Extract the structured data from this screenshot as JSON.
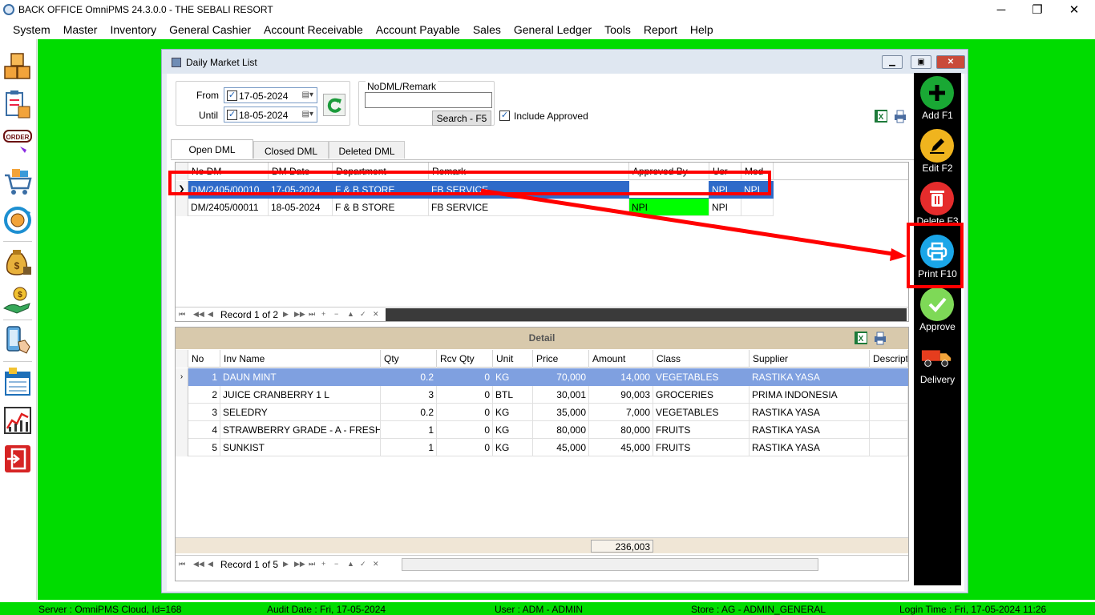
{
  "window": {
    "title": "BACK OFFICE OmniPMS 24.3.0.0 - THE SEBALI RESORT",
    "controls": {
      "minimize": "─",
      "restore": "❐",
      "close": "✕"
    }
  },
  "menu": [
    "System",
    "Master",
    "Inventory",
    "General Cashier",
    "Account Receivable",
    "Account Payable",
    "Sales",
    "General Ledger",
    "Tools",
    "Report",
    "Help"
  ],
  "left_toolbar": {
    "icons": [
      "boxes-icon",
      "clipboard-box-icon",
      "order-icon",
      "shopping-cart-icon",
      "sync-icon",
      "money-bag-icon",
      "hand-money-icon",
      "phone-touch-icon",
      "calendar-report-icon",
      "chart-icon",
      "exit-icon"
    ],
    "order_text": "ORDER"
  },
  "child_window": {
    "title": "Daily Market List",
    "filter": {
      "from_label": "From",
      "from_date": "17-05-2024",
      "until_label": "Until",
      "until_date": "18-05-2024",
      "nodml_label": "NoDML/Remark",
      "nodml_value": "",
      "search_button": "Search - F5",
      "include_approved_label": "Include Approved",
      "include_approved_checked": true
    },
    "tabs": [
      "Open DML",
      "Closed DML",
      "Deleted DML"
    ],
    "active_tab": "Open DML",
    "master_grid": {
      "columns": [
        "No DM",
        "DM Date",
        "Department",
        "Remark",
        "Approved By",
        "Usr",
        "Mod"
      ],
      "rows": [
        {
          "no_dm": "DM/2405/00010",
          "dm_date": "17-05-2024",
          "department": "F & B STORE",
          "remark": "FB SERVICE",
          "approved_by": "",
          "usr": "NPI",
          "mod": "NPI"
        },
        {
          "no_dm": "DM/2405/00011",
          "dm_date": "18-05-2024",
          "department": "F & B STORE",
          "remark": "FB SERVICE",
          "approved_by": "NPI",
          "usr": "NPI",
          "mod": ""
        }
      ],
      "record_text": "Record 1 of 2"
    },
    "detail": {
      "title": "Detail",
      "columns": [
        "No",
        "Inv Name",
        "Qty",
        "Rcv Qty",
        "Unit",
        "Price",
        "Amount",
        "Class",
        "Supplier",
        "Descripti"
      ],
      "rows": [
        {
          "no": "1",
          "inv_name": "DAUN MINT",
          "qty": "0.2",
          "rcv_qty": "0",
          "unit": "KG",
          "price": "70,000",
          "amount": "14,000",
          "class": "VEGETABLES",
          "supplier": "RASTIKA YASA"
        },
        {
          "no": "2",
          "inv_name": "JUICE CRANBERRY 1 L",
          "qty": "3",
          "rcv_qty": "0",
          "unit": "BTL",
          "price": "30,001",
          "amount": "90,003",
          "class": "GROCERIES",
          "supplier": "PRIMA INDONESIA"
        },
        {
          "no": "3",
          "inv_name": "SELEDRY",
          "qty": "0.2",
          "rcv_qty": "0",
          "unit": "KG",
          "price": "35,000",
          "amount": "7,000",
          "class": "VEGETABLES",
          "supplier": "RASTIKA YASA"
        },
        {
          "no": "4",
          "inv_name": "STRAWBERRY GRADE - A - FRESH",
          "qty": "1",
          "rcv_qty": "0",
          "unit": "KG",
          "price": "80,000",
          "amount": "80,000",
          "class": "FRUITS",
          "supplier": "RASTIKA YASA"
        },
        {
          "no": "5",
          "inv_name": "SUNKIST",
          "qty": "1",
          "rcv_qty": "0",
          "unit": "KG",
          "price": "45,000",
          "amount": "45,000",
          "class": "FRUITS",
          "supplier": "RASTIKA YASA"
        }
      ],
      "total_amount": "236,003",
      "record_text": "Record 1 of 5"
    },
    "actions": [
      {
        "label": "Add F1",
        "icon": "plus-icon",
        "color": "#19a834"
      },
      {
        "label": "Edit F2",
        "icon": "pencil-icon",
        "color": "#f0b41e"
      },
      {
        "label": "Delete F3",
        "icon": "trash-icon",
        "color": "#e52c2c"
      },
      {
        "label": "Print F10",
        "icon": "printer-icon",
        "color": "#1aa6e8"
      },
      {
        "label": "Approve",
        "icon": "check-icon",
        "color": "#7ed957"
      },
      {
        "label": "Delivery",
        "icon": "truck-icon",
        "color": "#e53d1e"
      }
    ]
  },
  "statusbar": {
    "server": "Server : OmniPMS Cloud, Id=168",
    "audit_date": "Audit Date : Fri, 17-05-2024",
    "user": "User : ADM - ADMIN",
    "store": "Store : AG - ADMIN_GENERAL",
    "login_time": "Login Time : Fri, 17-05-2024 11:26"
  },
  "colors": {
    "desktop": "#00dc00",
    "selection": "#2e6ac9",
    "approved": "#00ff00",
    "annotation": "#ff0000"
  }
}
